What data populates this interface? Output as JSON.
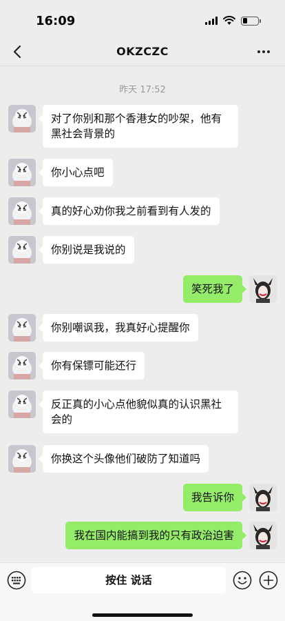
{
  "status_bar": {
    "time": "16:09",
    "battery_level": 0.3
  },
  "nav": {
    "title": "OKZCZC",
    "back_icon": "chevron-left-icon",
    "more_icon": "more-dots-icon"
  },
  "chat": {
    "timestamp": "昨天 17:52",
    "messages": [
      {
        "side": "in",
        "text": "对了你别和那个香港女的吵架，他有黑社会背景的"
      },
      {
        "side": "in",
        "text": "你小心点吧"
      },
      {
        "side": "in",
        "text": "真的好心劝你我之前看到有人发的"
      },
      {
        "side": "in",
        "text": "你别说是我说的"
      },
      {
        "side": "out",
        "text": "笑死我了"
      },
      {
        "side": "in",
        "text": "你别嘲讽我，我真好心提醒你"
      },
      {
        "side": "in",
        "text": "你有保镖可能还行"
      },
      {
        "side": "in",
        "text": "反正真的小心点他貌似真的认识黑社会的"
      },
      {
        "side": "in",
        "text": "你换这个头像他们破防了知道吗"
      },
      {
        "side": "out",
        "text": "我告诉你"
      },
      {
        "side": "out",
        "text": "我在国内能搞到我的只有政治迫害"
      }
    ]
  },
  "input_bar": {
    "hold_to_talk_label": "按住 说话",
    "keyboard_icon": "keyboard-icon",
    "emoji_icon": "emoji-icon",
    "plus_icon": "plus-icon"
  },
  "colors": {
    "background": "#ededed",
    "outgoing_bubble": "#95ec69",
    "incoming_bubble": "#ffffff"
  }
}
